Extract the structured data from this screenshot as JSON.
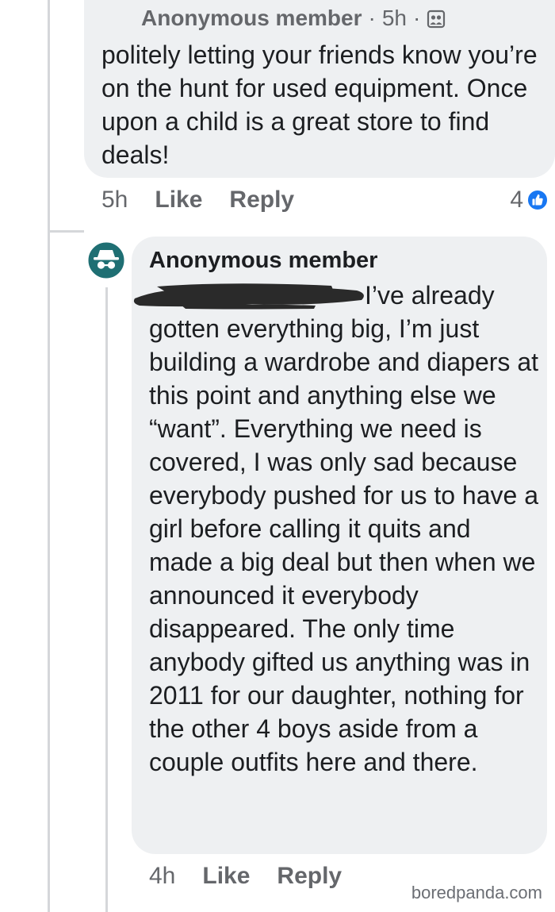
{
  "top_comment": {
    "author": "Anonymous member",
    "separator": "·",
    "time_label": "5h",
    "privacy_icon": "group-members-icon",
    "text": "politely letting your friends know you’re on the hunt for used equipment. Once upon a child is a great store to find deals!",
    "actions": {
      "time": "5h",
      "like": "Like",
      "reply": "Reply"
    },
    "reaction_count": "4",
    "reaction_icon": "like-badge-icon"
  },
  "reply_comment": {
    "author": "Anonymous member",
    "avatar_icon": "anonymous-avatar-icon",
    "text": "I’ve already gotten everything big, I’m just building a wardrobe and diapers at this point and anything else we “want”. Everything we need is covered, I was only sad because everybody pushed for us to have a girl before calling it quits and made a big deal but then when we announced it everybody disappeared. The only time anybody gifted us anything was in 2011 for our daughter, nothing for the other 4 boys aside from a couple outfits here and there.",
    "actions": {
      "time": "4h",
      "like": "Like",
      "reply": "Reply"
    }
  },
  "watermark": "boredpanda.com",
  "colors": {
    "bubble": "#eef0f2",
    "secondary_text": "#65676b",
    "like_blue": "#1877f2",
    "avatar_teal": "#1f6f73"
  }
}
